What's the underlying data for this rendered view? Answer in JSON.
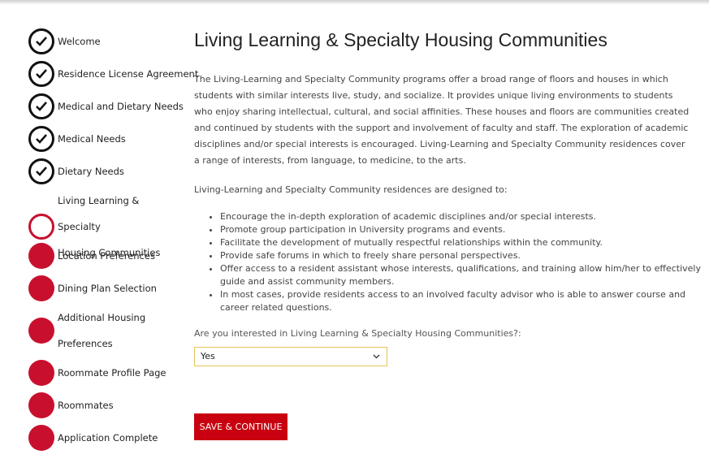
{
  "steps": [
    {
      "label": "Welcome",
      "status": "done"
    },
    {
      "label": "Residence License Agreement",
      "status": "done"
    },
    {
      "label": "Medical and Dietary Needs",
      "status": "done"
    },
    {
      "label": "Medical Needs",
      "status": "done"
    },
    {
      "label": "Dietary Needs",
      "status": "done"
    },
    {
      "label_line1": "Living Learning & Specialty",
      "label_line2": "Housing Communities",
      "status": "current"
    },
    {
      "label": "Location Preferences",
      "status": "todo"
    },
    {
      "label": "Dining Plan Selection",
      "status": "todo"
    },
    {
      "label_line1": "Additional Housing",
      "label_line2": "Preferences",
      "status": "todo"
    },
    {
      "label": "Roommate Profile Page",
      "status": "todo"
    },
    {
      "label": "Roommates",
      "status": "todo"
    },
    {
      "label": "Application Complete",
      "status": "todo"
    }
  ],
  "main": {
    "title": "Living Learning & Specialty Housing Communities",
    "intro": "The Living-Learning and Specialty Community programs offer a broad range of floors and houses in which students with similar interests live, study, and socialize. It provides unique living environments to students who enjoy sharing intellectual, cultural, and social affinities. These houses and floors are communities created and continued by students with the support and involvement of faculty and staff. The exploration of academic disciplines and/or special interests is encouraged. Living-Learning and Specialty Community residences cover a range of interests, from language, to medicine, to the arts.",
    "designed_to": "Living-Learning and Specialty Community residences are designed to:",
    "bullets": [
      "Encourage the in-depth exploration of academic disciplines and/or special interests.",
      "Promote group participation in University programs and events.",
      "Facilitate the development of mutually respectful relationships within the community.",
      "Provide safe forums in which to freely share personal perspectives.",
      "Offer access to a resident assistant whose interests, qualifications, and training allow him/her to effectively guide and assist community members.",
      "In most cases, provide residents access to an involved faculty advisor who is able to answer course and career related questions."
    ],
    "question": "Are you interested in Living Learning & Specialty Housing Communities?:",
    "select_value": "Yes",
    "save_label": "SAVE & CONTINUE"
  },
  "colors": {
    "accent": "#c8102e",
    "button": "#c8000f",
    "select_border": "#e6c35c"
  }
}
